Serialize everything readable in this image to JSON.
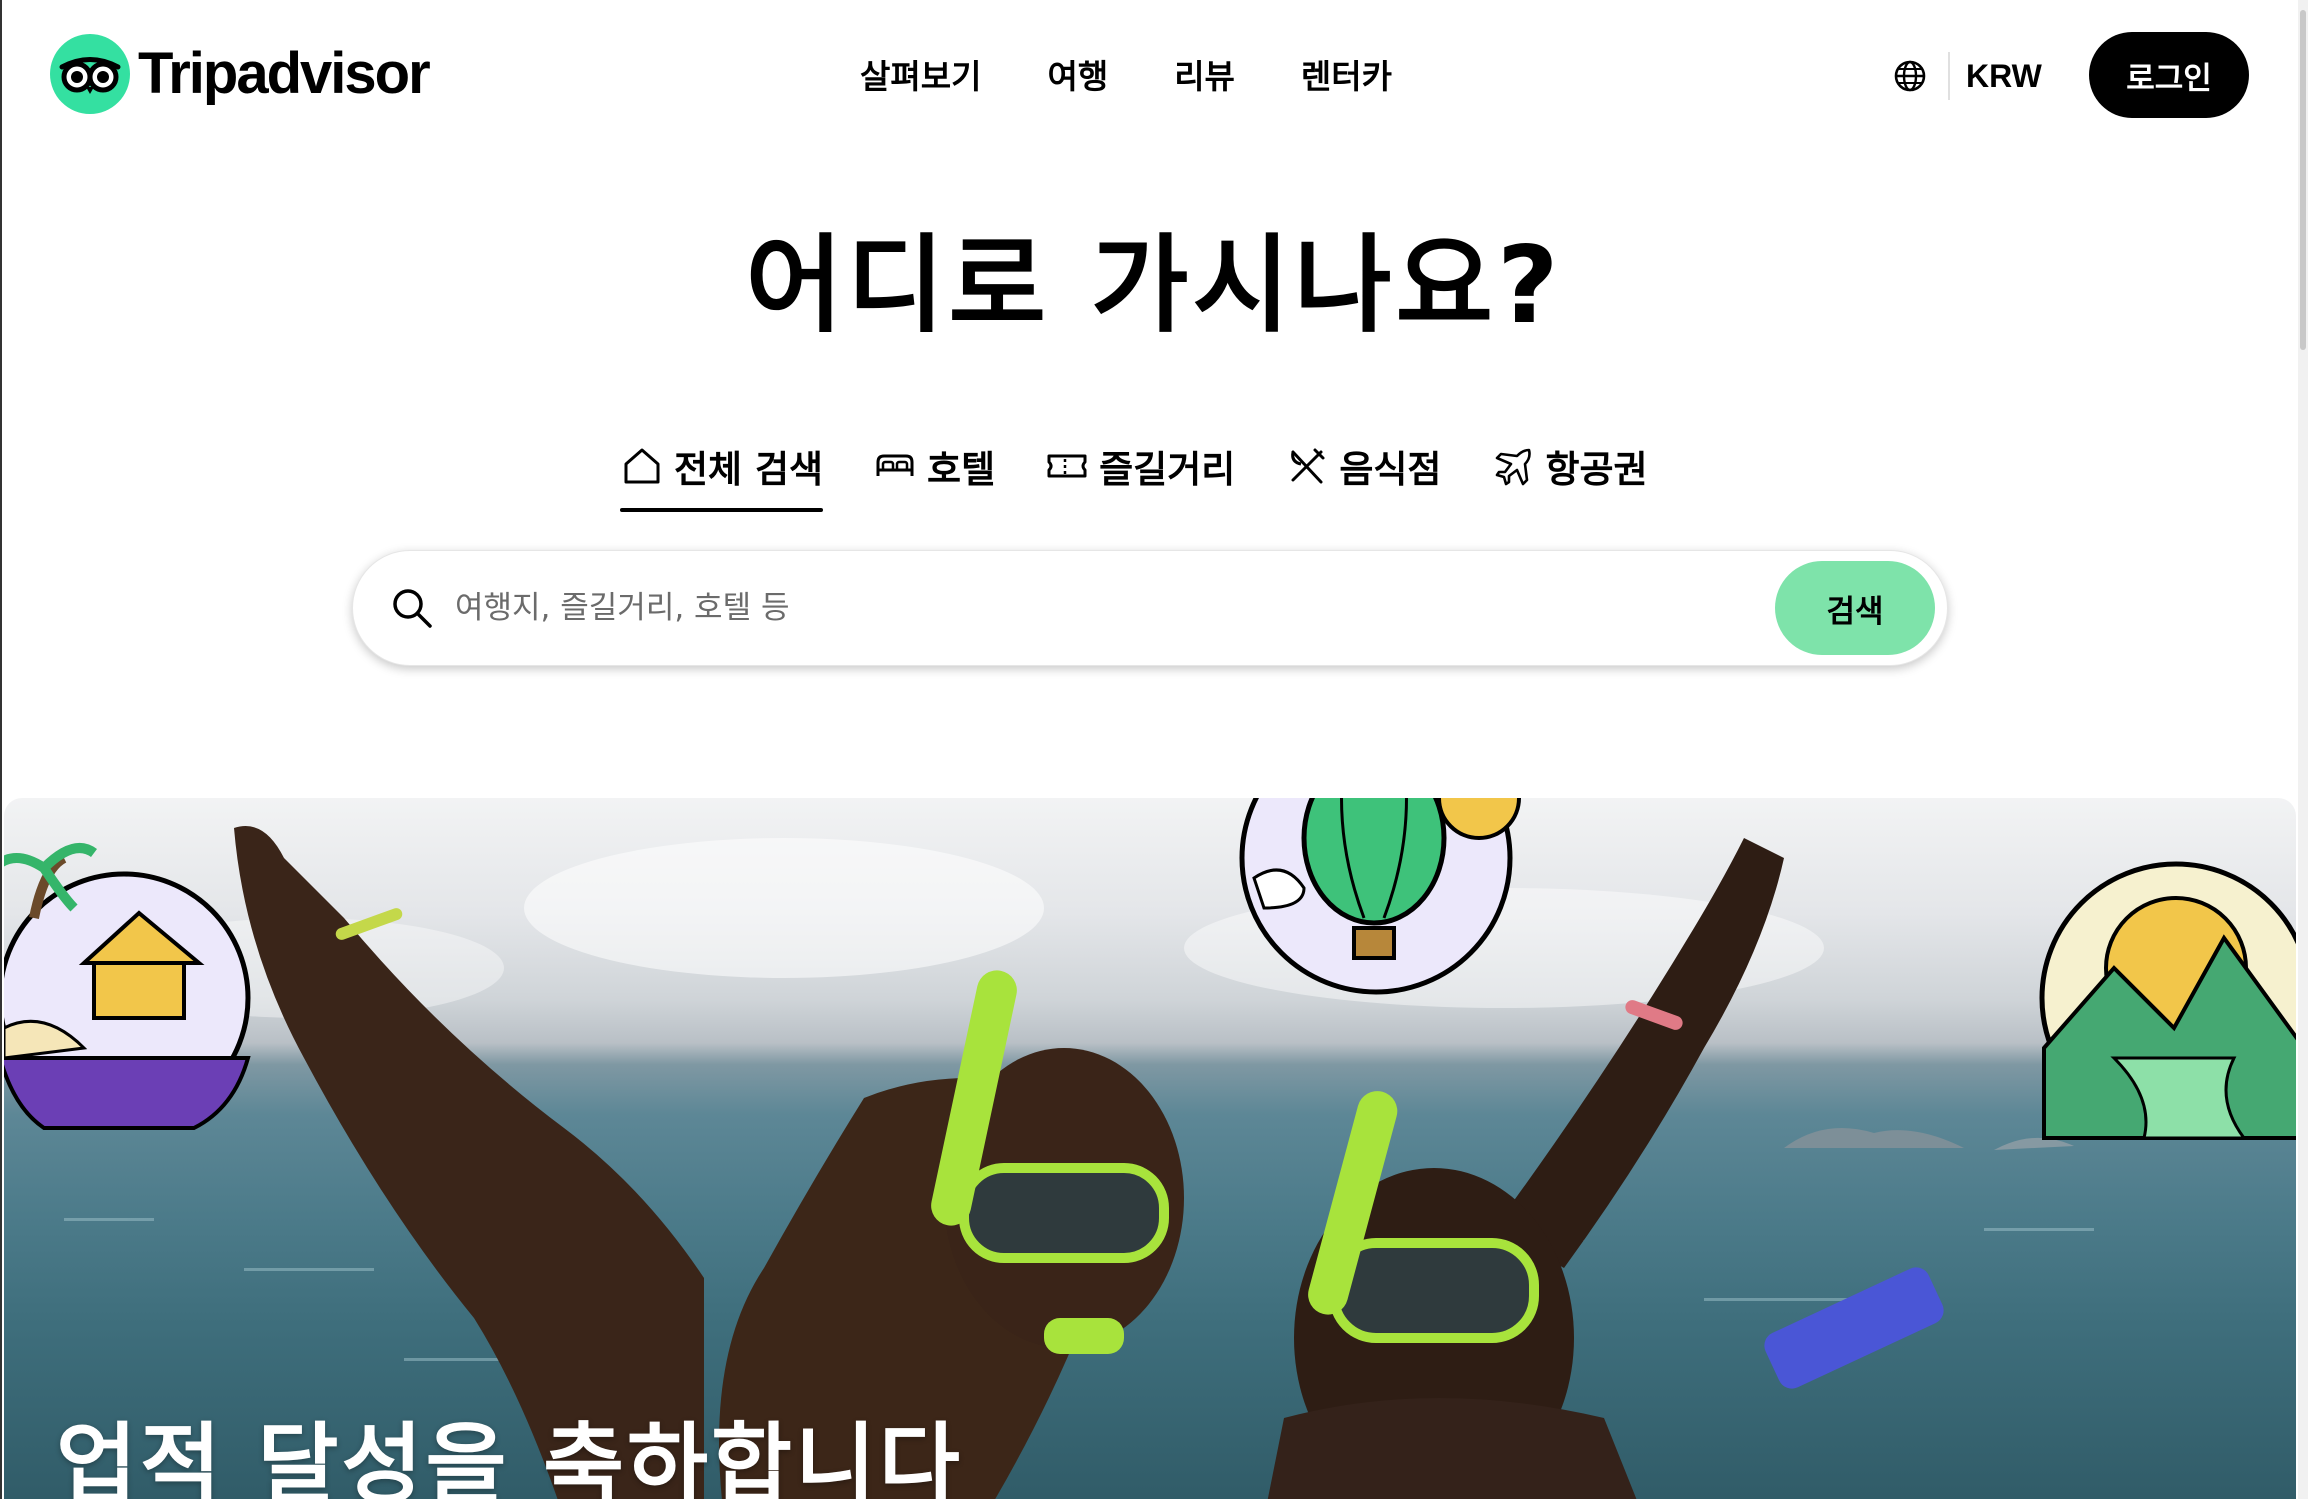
{
  "brand": {
    "name": "Tripadvisor",
    "accent_color": "#34e0a1"
  },
  "nav": {
    "items": [
      {
        "label": "살펴보기"
      },
      {
        "label": "여행"
      },
      {
        "label": "리뷰"
      },
      {
        "label": "렌터카"
      }
    ]
  },
  "header": {
    "language_icon": "globe-icon",
    "currency": "KRW",
    "login_label": "로그인"
  },
  "hero": {
    "title": "어디로 가시나요?"
  },
  "tabs": [
    {
      "label": "전체 검색",
      "icon": "home-icon",
      "active": true
    },
    {
      "label": "호텔",
      "icon": "bed-icon",
      "active": false
    },
    {
      "label": "즐길거리",
      "icon": "ticket-icon",
      "active": false
    },
    {
      "label": "음식점",
      "icon": "utensils-icon",
      "active": false
    },
    {
      "label": "항공권",
      "icon": "plane-icon",
      "active": false
    }
  ],
  "search": {
    "placeholder": "여행지, 즐길거리, 호텔 등",
    "value": "",
    "button_label": "검색",
    "button_color": "#7ee3aa"
  },
  "banner": {
    "heading": "업적 달성을 축하합니다"
  }
}
